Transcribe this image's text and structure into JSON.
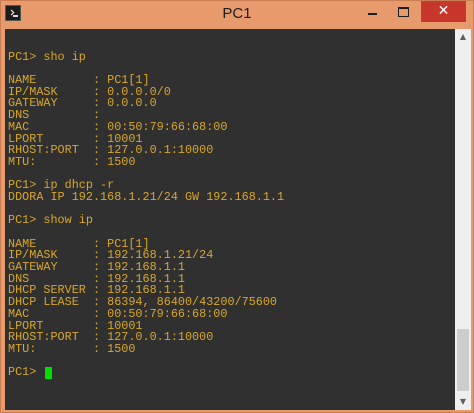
{
  "window": {
    "title": "PC1",
    "icon": "console-icon",
    "minimize_icon": "minimize-icon",
    "maximize_icon": "maximize-icon",
    "close_glyph": "✕"
  },
  "console": {
    "lines": [
      "",
      "PC1> sho ip",
      "",
      "NAME        : PC1[1]",
      "IP/MASK     : 0.0.0.0/0",
      "GATEWAY     : 0.0.0.0",
      "DNS         :",
      "MAC         : 00:50:79:66:68:00",
      "LPORT       : 10001",
      "RHOST:PORT  : 127.0.0.1:10000",
      "MTU:        : 1500",
      "",
      "PC1> ip dhcp -r",
      "DDORA IP 192.168.1.21/24 GW 192.168.1.1",
      "",
      "PC1> show ip",
      "",
      "NAME        : PC1[1]",
      "IP/MASK     : 192.168.1.21/24",
      "GATEWAY     : 192.168.1.1",
      "DNS         : 192.168.1.1",
      "DHCP SERVER : 192.168.1.1",
      "DHCP LEASE  : 86394, 86400/43200/75600",
      "MAC         : 00:50:79:66:68:00",
      "LPORT       : 10001",
      "RHOST:PORT  : 127.0.0.1:10000",
      "MTU:        : 1500",
      "",
      "PC1> "
    ],
    "text_color": "#d9a629",
    "background_color": "#303030",
    "cursor_color": "#00e000"
  },
  "scrollbar": {
    "up_glyph": "▲",
    "down_glyph": "▼"
  },
  "colors": {
    "titlebar": "#e79a6b",
    "close_button": "#c7372c"
  }
}
